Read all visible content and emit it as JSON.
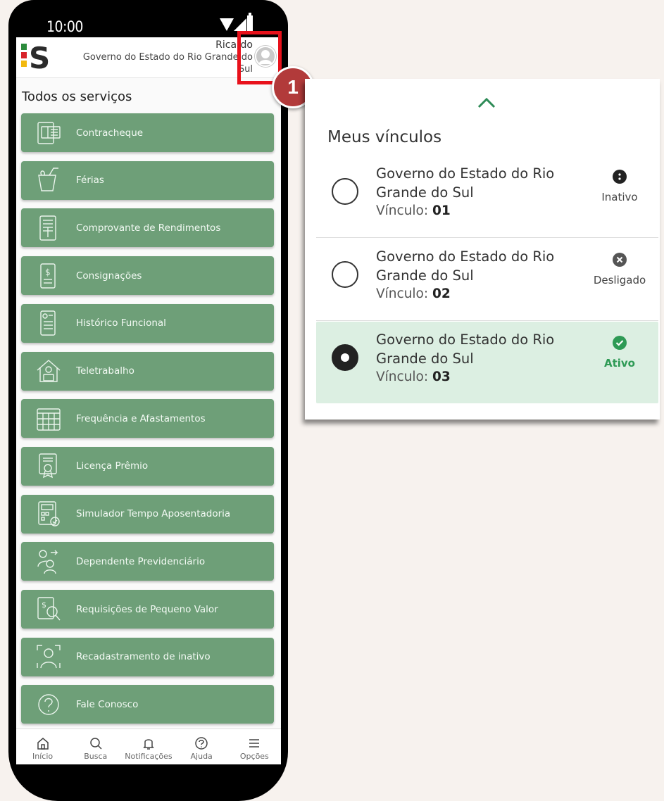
{
  "status_bar": {
    "time": "10:00"
  },
  "app_header": {
    "user_name": "Ricardo",
    "org_name": "Governo do Estado do Rio Grande do Sul"
  },
  "services": {
    "title": "Todos os serviços",
    "items": [
      {
        "label": "Contracheque",
        "icon": "paycheck-icon"
      },
      {
        "label": "Férias",
        "icon": "drink-icon"
      },
      {
        "label": "Comprovante de Rendimentos",
        "icon": "income-statement-icon"
      },
      {
        "label": "Consignações",
        "icon": "loan-document-icon"
      },
      {
        "label": "Histórico Funcional",
        "icon": "employment-history-icon"
      },
      {
        "label": "Teletrabalho",
        "icon": "remote-work-icon"
      },
      {
        "label": "Frequência e Afastamentos",
        "icon": "calendar-icon"
      },
      {
        "label": "Licença Prêmio",
        "icon": "certificate-icon"
      },
      {
        "label": "Simulador Tempo Aposentadoria",
        "icon": "calculator-icon"
      },
      {
        "label": "Dependente Previdenciário",
        "icon": "dependents-icon"
      },
      {
        "label": "Requisições de Pequeno Valor",
        "icon": "search-document-icon"
      },
      {
        "label": "Recadastramento de inativo",
        "icon": "face-scan-icon"
      },
      {
        "label": "Fale Conosco",
        "icon": "help-icon"
      }
    ]
  },
  "bottom_nav": [
    {
      "label": "Início",
      "icon": "home-icon"
    },
    {
      "label": "Busca",
      "icon": "search-icon"
    },
    {
      "label": "Notificações",
      "icon": "bell-icon"
    },
    {
      "label": "Ajuda",
      "icon": "help-circle-icon"
    },
    {
      "label": "Opções",
      "icon": "menu-icon"
    }
  ],
  "callout": {
    "step_number": "1"
  },
  "bonds_panel": {
    "title": "Meus vínculos",
    "bonds": [
      {
        "org": "Governo do Estado do Rio Grande do Sul",
        "bond_label": "Vínculo:",
        "bond_number": "01",
        "status": "Inativo",
        "status_color": "#222222",
        "selected": false
      },
      {
        "org": "Governo do Estado do Rio Grande do Sul",
        "bond_label": "Vínculo:",
        "bond_number": "02",
        "status": "Desligado",
        "status_color": "#555555",
        "selected": false
      },
      {
        "org": "Governo do Estado do Rio Grande do Sul",
        "bond_label": "Vínculo:",
        "bond_number": "03",
        "status": "Ativo",
        "status_color": "#2e9a55",
        "selected": true
      }
    ]
  },
  "colors": {
    "primary_green": "#6e9f78",
    "active_green": "#2e9a55",
    "active_bg": "#dcefe2",
    "highlight_red": "#e8111b"
  }
}
